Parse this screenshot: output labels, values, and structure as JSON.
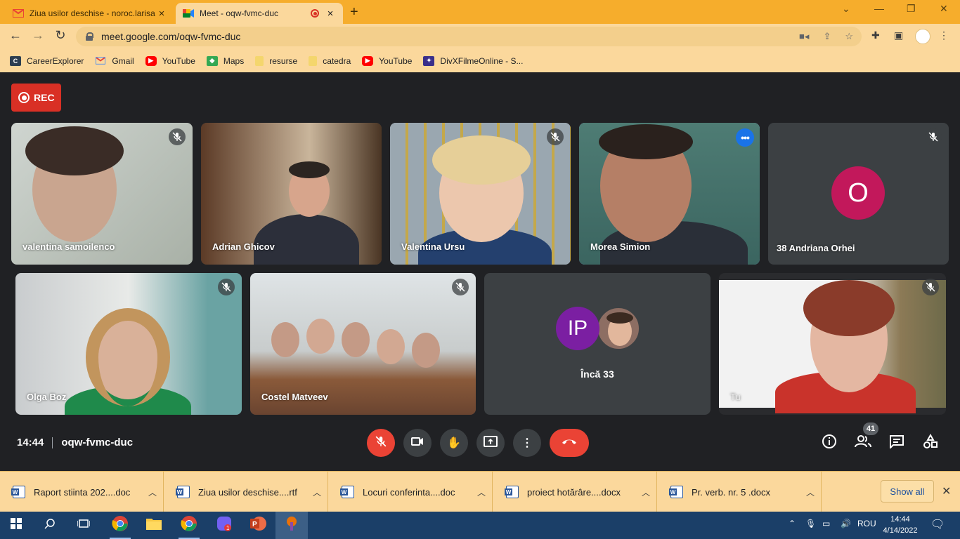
{
  "browser": {
    "tabs": [
      {
        "title": "Ziua usilor deschise - noroc.larisa",
        "favicon": "gmail-icon"
      },
      {
        "title": "Meet - oqw-fvmc-duc",
        "favicon": "meet-icon",
        "recording": true
      }
    ],
    "url": "meet.google.com/oqw-fvmc-duc",
    "bookmarks": [
      {
        "label": "CareerExplorer",
        "icon": "careerexplorer-icon",
        "color": "#2d3e50"
      },
      {
        "label": "Gmail",
        "icon": "gmail-icon",
        "color": "#ea4335"
      },
      {
        "label": "YouTube",
        "icon": "youtube-icon",
        "color": "#ff0000"
      },
      {
        "label": "Maps",
        "icon": "maps-icon",
        "color": "#34a853"
      },
      {
        "label": "resurse",
        "icon": "folder-icon",
        "color": "#f4d66d"
      },
      {
        "label": "catedra",
        "icon": "folder-icon",
        "color": "#f4d66d"
      },
      {
        "label": "YouTube",
        "icon": "youtube-icon",
        "color": "#ff0000"
      },
      {
        "label": "DivXFilmeOnline - S...",
        "icon": "divx-icon",
        "color": "#3a2f8a"
      }
    ]
  },
  "meet": {
    "rec_label": "REC",
    "participants": [
      {
        "name": "valentina samoilenco",
        "muted": true
      },
      {
        "name": "Adrian Ghicov",
        "muted": false
      },
      {
        "name": "Valentina Ursu",
        "muted": true
      },
      {
        "name": "Morea Simion",
        "muted": false,
        "speaking": true
      },
      {
        "name": "38 Andriana Orhei",
        "muted": true,
        "avatar_letter": "O",
        "avatar_color": "#c2185b"
      },
      {
        "name": "Olga Boz",
        "muted": true
      },
      {
        "name": "Costel Matveev",
        "muted": true
      },
      {
        "name": "Tu",
        "muted": true
      }
    ],
    "others": {
      "avatar_letters": "IP",
      "avatar_color": "#7b1fa2",
      "label": "Încă 33"
    },
    "time": "14:44",
    "meeting_code": "oqw-fvmc-duc",
    "participant_count": "41",
    "accent": "#ea4335"
  },
  "downloads": {
    "files": [
      "Raport stiinta 202....doc",
      "Ziua usilor deschise....rtf",
      "Locuri  conferinta....doc",
      "proiect hotărâre....docx",
      "Pr. verb. nr. 5 .docx"
    ],
    "show_all": "Show all"
  },
  "taskbar": {
    "lang": "ROU",
    "time": "14:44",
    "date": "4/14/2022"
  }
}
